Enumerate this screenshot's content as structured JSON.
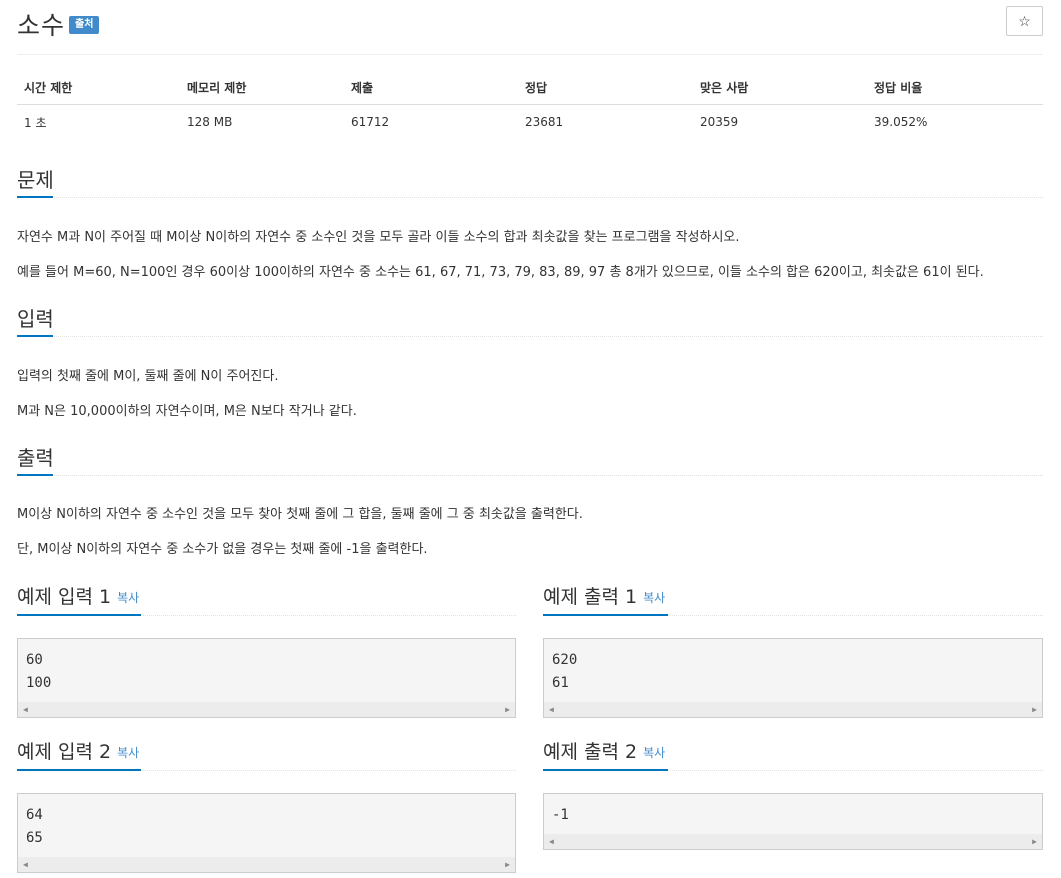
{
  "problem": {
    "title": "소수",
    "badge": "출처",
    "star": "☆"
  },
  "info": {
    "headers": [
      "시간 제한",
      "메모리 제한",
      "제출",
      "정답",
      "맞은 사람",
      "정답 비율"
    ],
    "values": [
      "1 초",
      "128 MB",
      "61712",
      "23681",
      "20359",
      "39.052%"
    ]
  },
  "sections": {
    "problem": {
      "heading": "문제",
      "p1": "자연수 M과 N이 주어질 때 M이상 N이하의 자연수 중 소수인 것을 모두 골라 이들 소수의 합과 최솟값을 찾는 프로그램을 작성하시오.",
      "p2": "예를 들어 M=60, N=100인 경우 60이상 100이하의 자연수 중 소수는 61, 67, 71, 73, 79, 83, 89, 97 총 8개가 있으므로, 이들 소수의 합은 620이고, 최솟값은 61이 된다."
    },
    "input": {
      "heading": "입력",
      "p1": "입력의 첫째 줄에 M이, 둘째 줄에 N이 주어진다.",
      "p2": "M과 N은 10,000이하의 자연수이며, M은 N보다 작거나 같다."
    },
    "output": {
      "heading": "출력",
      "p1": "M이상 N이하의 자연수 중 소수인 것을 모두 찾아 첫째 줄에 그 합을, 둘째 줄에 그 중 최솟값을 출력한다.",
      "p2": "단, M이상 N이하의 자연수 중 소수가 없을 경우는 첫째 줄에 -1을 출력한다."
    }
  },
  "samples": {
    "copy_label": "복사",
    "in1": {
      "heading": "예제 입력 1",
      "line1": "60",
      "line2": "100"
    },
    "out1": {
      "heading": "예제 출력 1",
      "line1": "620",
      "line2": "61"
    },
    "in2": {
      "heading": "예제 입력 2",
      "line1": "64",
      "line2": "65"
    },
    "out2": {
      "heading": "예제 출력 2",
      "line1": "-1"
    }
  },
  "scroll": {
    "left": "◀",
    "right": "▶"
  }
}
